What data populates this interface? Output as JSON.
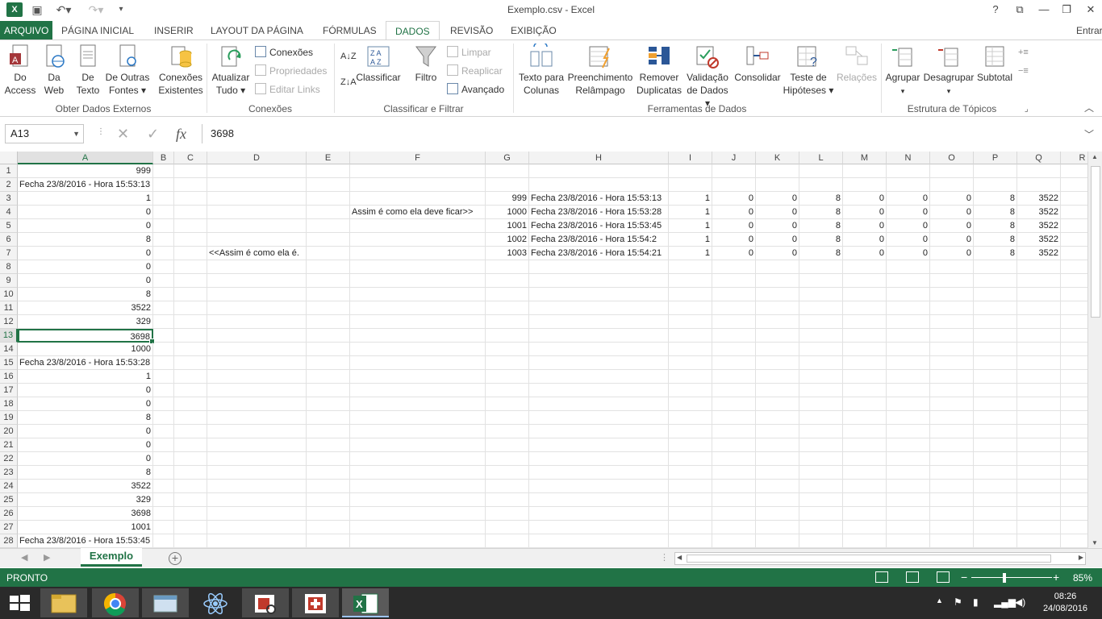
{
  "window": {
    "title": "Exemplo.csv - Excel",
    "help": "?",
    "user": "Entrar"
  },
  "tabs": [
    "ARQUIVO",
    "PÁGINA INICIAL",
    "INSERIR",
    "LAYOUT DA PÁGINA",
    "FÓRMULAS",
    "DADOS",
    "REVISÃO",
    "EXIBIÇÃO"
  ],
  "ribbon": {
    "ext_data": {
      "access": [
        "Do",
        "Access"
      ],
      "web": [
        "Da",
        "Web"
      ],
      "text": [
        "De",
        "Texto"
      ],
      "other": [
        "De Outras",
        "Fontes ▾"
      ],
      "existing": [
        "Conexões",
        "Existentes"
      ],
      "label": "Obter Dados Externos"
    },
    "connections": {
      "refresh": [
        "Atualizar",
        "Tudo ▾"
      ],
      "conn": "Conexões",
      "props": "Propriedades",
      "edit_links": "Editar Links",
      "label": "Conexões"
    },
    "sort_filter": {
      "sort": "Classificar",
      "filter": "Filtro",
      "clear": "Limpar",
      "reapply": "Reaplicar",
      "advanced": "Avançado",
      "label": "Classificar e Filtrar"
    },
    "data_tools": {
      "text_to_cols": [
        "Texto para",
        "Colunas"
      ],
      "flash_fill": [
        "Preenchimento",
        "Relâmpago"
      ],
      "remove_dup": [
        "Remover",
        "Duplicatas"
      ],
      "validation": [
        "Validação",
        "de Dados ▾"
      ],
      "consolidate": "Consolidar",
      "what_if": [
        "Teste de",
        "Hipóteses ▾"
      ],
      "relations": "Relações",
      "label": "Ferramentas de Dados"
    },
    "outline": {
      "group": "Agrupar",
      "ungroup": "Desagrupar",
      "subtotal": "Subtotal",
      "label": "Estrutura de Tópicos"
    }
  },
  "formula_bar": {
    "name_box": "A13",
    "fx": "fx",
    "value": "3698"
  },
  "columns": [
    "A",
    "B",
    "C",
    "D",
    "E",
    "F",
    "G",
    "H",
    "I",
    "J",
    "K",
    "L",
    "M",
    "N",
    "O",
    "P",
    "Q",
    "R"
  ],
  "rows": [
    "1",
    "2",
    "3",
    "4",
    "5",
    "6",
    "7",
    "8",
    "9",
    "10",
    "11",
    "12",
    "13",
    "14",
    "15",
    "16",
    "17",
    "18",
    "19",
    "20",
    "21",
    "22",
    "23",
    "24",
    "25",
    "26",
    "27",
    "28"
  ],
  "colA": [
    "999",
    "Fecha 23/8/2016 - Hora 15:53:13",
    "1",
    "0",
    "0",
    "8",
    "0",
    "0",
    "0",
    "8",
    "3522",
    "329",
    "3698",
    "1000",
    "Fecha 23/8/2016 - Hora 15:53:28",
    "1",
    "0",
    "0",
    "8",
    "0",
    "0",
    "0",
    "8",
    "3522",
    "329",
    "3698",
    "1001",
    "Fecha 23/8/2016 - Hora 15:53:45"
  ],
  "notes": {
    "f4": "Assim é como ela deve ficar>>",
    "d7": "<<Assim é como ela é."
  },
  "table_rows": [
    [
      "999",
      "Fecha 23/8/2016 - Hora 15:53:13",
      "1",
      "0",
      "0",
      "8",
      "0",
      "0",
      "0",
      "8",
      "3522"
    ],
    [
      "1000",
      "Fecha 23/8/2016 - Hora 15:53:28",
      "1",
      "0",
      "0",
      "8",
      "0",
      "0",
      "0",
      "8",
      "3522"
    ],
    [
      "1001",
      "Fecha 23/8/2016 - Hora 15:53:45",
      "1",
      "0",
      "0",
      "8",
      "0",
      "0",
      "0",
      "8",
      "3522"
    ],
    [
      "1002",
      "Fecha 23/8/2016 - Hora 15:54:2",
      "1",
      "0",
      "0",
      "8",
      "0",
      "0",
      "0",
      "8",
      "3522"
    ],
    [
      "1003",
      "Fecha 23/8/2016 - Hora 15:54:21",
      "1",
      "0",
      "0",
      "8",
      "0",
      "0",
      "0",
      "8",
      "3522"
    ]
  ],
  "sheet_tab": "Exemplo",
  "status": {
    "mode": "PRONTO",
    "zoom": "85%"
  },
  "taskbar": {
    "time": "08:26",
    "date": "24/08/2016"
  }
}
